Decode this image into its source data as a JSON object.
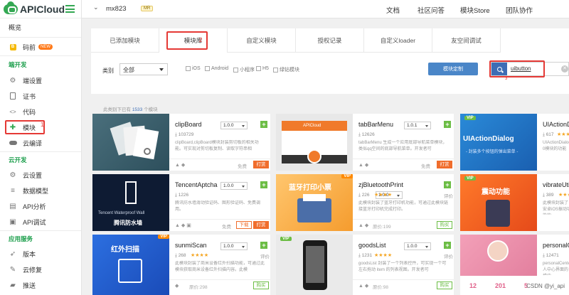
{
  "brand": {
    "name": "APICloud"
  },
  "topbar": {
    "user": "mx823",
    "user_tag": "MR",
    "nav": [
      "文档",
      "社区问答",
      "模块Store",
      "团队协作"
    ]
  },
  "sidebar": {
    "overview": "概览",
    "code_front": {
      "label": "码前",
      "badge": "NEW"
    },
    "dev_header": "端开发",
    "dev_items": [
      "端设置",
      "证书",
      "代码",
      "模块",
      "云编译"
    ],
    "cloud_header": "云开发",
    "cloud_items": [
      "云设置",
      "数据模型",
      "API分析",
      "API调试"
    ],
    "service_header": "应用服务",
    "service_items": [
      "版本",
      "云修复",
      "推送"
    ]
  },
  "tabs": [
    "已添加模块",
    "模块库",
    "自定义模块",
    "授权记录",
    "自定义loader",
    "友空间调试"
  ],
  "filters": {
    "category_label": "类别",
    "category_value": "全部",
    "platforms": [
      "iOS",
      "Android",
      "小程序",
      "H5",
      "绿钻模块"
    ],
    "custom_button": "模块定制",
    "search_value": "uibutton"
  },
  "annotations": {
    "tab": "2",
    "search": "3",
    "module": "1"
  },
  "count": {
    "prefix": "此类别下已有",
    "number": "1533",
    "suffix": "个模块"
  },
  "cards": [
    {
      "title": "clipBoard",
      "version": "1.0.0",
      "downloads": "103729",
      "stars": "",
      "desc": "clipBoard,clipBoard模块封装剪切板的相关功能。可实现对剪切板复制、读取字符串相",
      "price": "免费",
      "action": "打赏",
      "art": "clipboard"
    },
    {
      "title": "tabBarMenu",
      "version": "1.0.1",
      "downloads": "12626",
      "stars": "",
      "desc": "tabBarMenu 生成一个应用底部导航菜单模块，类似qq空间的底部导航菜单。开发者可",
      "price": "免费",
      "action": "打赏",
      "art": "tabbar",
      "art_text": "APICloud"
    },
    {
      "title": "UIActionDi",
      "version": "",
      "downloads": "617",
      "stars": "★★★★",
      "desc": "UIActionDialog 0模块的功能",
      "price": "",
      "action": "",
      "art": "actiondialog",
      "vip": "VIP",
      "art_title": "UIActionDialog",
      "art_sub": "- 封装多个按钮的弹出菜单 -"
    },
    {
      "title": "TencentAptcha",
      "version": "1.0.0",
      "downloads": "1226",
      "stars": "",
      "desc": "腾讯防水墙滑动验证码、图形验证码、免费调用。",
      "price": "免费",
      "action": "下载",
      "action2": "打赏",
      "art": "tencent",
      "art_text": "Tencent Waterproof Wall",
      "art_cn": "腾讯防水墙"
    },
    {
      "title": "zjBluetoothPrint",
      "version": "1.0.0",
      "downloads": "226",
      "stars": "★★★★",
      "evaluate": "评价",
      "desc": "此模块封装了蓝牙打印机功能，可通过此模块链接蓝牙打印机完成打印。",
      "price": "原价:199",
      "action": "购买",
      "art": "bluetooth",
      "vip": "VIP",
      "art_title": "蓝牙打印小票"
    },
    {
      "title": "vibrateUti",
      "version": "",
      "downloads": "389",
      "stars": "★★★★",
      "desc": "此模块封装了安卓iOS振动功能的",
      "price": "",
      "action": "",
      "art": "vibrate",
      "vip": "VIP",
      "art_title": "震动功能"
    },
    {
      "title": "sunmiScan",
      "version": "1.0.0",
      "downloads": "268",
      "stars": "★★★★",
      "evaluate": "评价",
      "desc": "此模块封装了商米设备红外扫描功能，可通过此模块获取商米设备红外扫描内容。此模",
      "price": "原价:298",
      "action": "购买",
      "art": "sunmi",
      "vip": "VIP",
      "art_title": "红外扫描"
    },
    {
      "title": "goodsList",
      "version": "1.0.0",
      "downloads": "1231",
      "stars": "★★★★",
      "evaluate": "评价",
      "desc": "goodsList 封装了一个列表控件，可实现一个可左右拖动 item 的列表视图。开发者可",
      "price": "原价:98",
      "action": "购买",
      "art": "goods",
      "vip": "VIP"
    },
    {
      "title": "personalCe",
      "version": "",
      "downloads": "12471",
      "stars": "",
      "desc": "personalCenter 人中心界面的模块",
      "price": "",
      "action": "",
      "art": "personal",
      "art_stats": [
        "12",
        "201",
        "5"
      ]
    }
  ],
  "watermark": "CSDN @yi_api",
  "colors": {
    "brand_green": "#34a853",
    "annotation_red": "#e53935",
    "primary_blue": "#4a86c8",
    "action_orange": "#f06d2c"
  }
}
